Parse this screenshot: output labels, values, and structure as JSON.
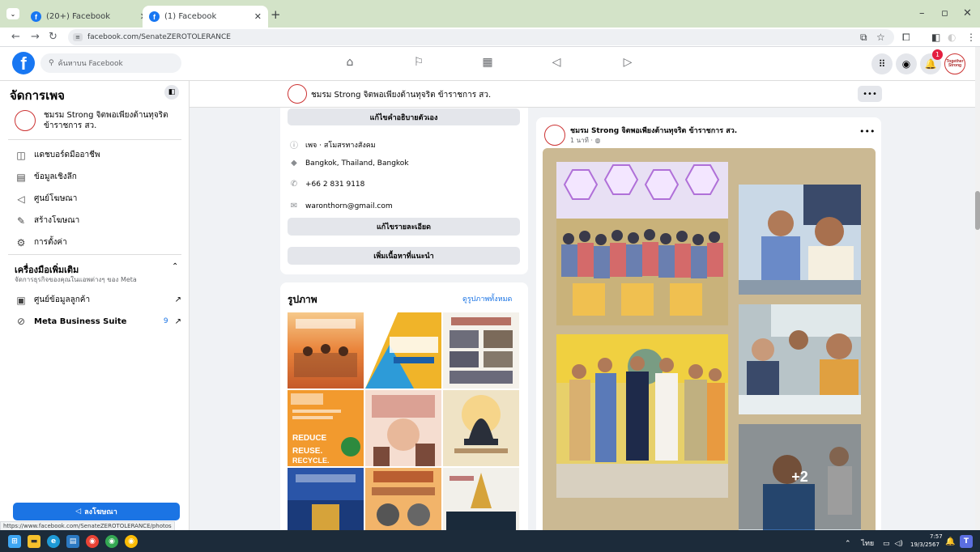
{
  "browser": {
    "tabs": [
      {
        "title": "(20+) Facebook",
        "active": false
      },
      {
        "title": "(1) Facebook",
        "active": true
      }
    ],
    "url": "facebook.com/SenateZEROTOLERANCE",
    "status_url": "https://www.facebook.com/SenateZEROTOLERANCE/photos"
  },
  "fb_header": {
    "search_placeholder": "ค้นหาบน Facebook",
    "nav_icons": [
      "home-icon",
      "flag-icon",
      "stats-icon",
      "megaphone-icon",
      "video-icon"
    ],
    "notification_count": "1",
    "avatar_text": "Together Strong"
  },
  "sidebar": {
    "title": "จัดการเพจ",
    "page_name": "ชมรม Strong จิตพอเพียงต้านทุจริต ข้าราชการ สว.",
    "items": [
      {
        "label": "แดชบอร์ดมืออาชีพ",
        "icon": "dashboard-icon"
      },
      {
        "label": "ข้อมูลเชิงลึก",
        "icon": "insights-icon"
      },
      {
        "label": "ศูนย์โฆษณา",
        "icon": "ad-center-icon"
      },
      {
        "label": "สร้างโฆษณา",
        "icon": "create-ad-icon"
      },
      {
        "label": "การตั้งค่า",
        "icon": "settings-icon"
      }
    ],
    "tools_heading": "เครื่องมือเพิ่มเติม",
    "tools_sub": "จัดการธุรกิจของคุณในแอพต่างๆ ของ Meta",
    "tools": [
      {
        "label": "ศูนย์ข้อมูลลูกค้า",
        "badge": ""
      },
      {
        "label": "Meta Business Suite",
        "badge": "9"
      }
    ],
    "advertise_button": "ลงโฆษณา"
  },
  "page_header": {
    "name": "ชมรม Strong จิตพอเพียงต้านทุจริต ข้าราชการ สว."
  },
  "intro": {
    "edit_bio": "แก้ไขคำอธิบายตัวเอง",
    "category": "เพจ · สโมสรทางสังคม",
    "location": "Bangkok, Thailand, Bangkok",
    "phone": "+66 2 831 9118",
    "email": "waronthorn@gmail.com",
    "edit_details": "แก้ไขรายละเอียด",
    "add_featured": "เพิ่มเนื้อหาที่แนะนำ"
  },
  "photos": {
    "title": "รูปภาพ",
    "see_all": "ดูรูปภาพทั้งหมด"
  },
  "post": {
    "author": "ชมรม Strong จิตพอเพียงต้านทุจริต ข้าราชการ สว.",
    "time": "1 นาที · ",
    "more_photos": "+2"
  },
  "taskbar": {
    "lang": "ไทย",
    "time": "7:57",
    "date": "19/3/2567"
  }
}
